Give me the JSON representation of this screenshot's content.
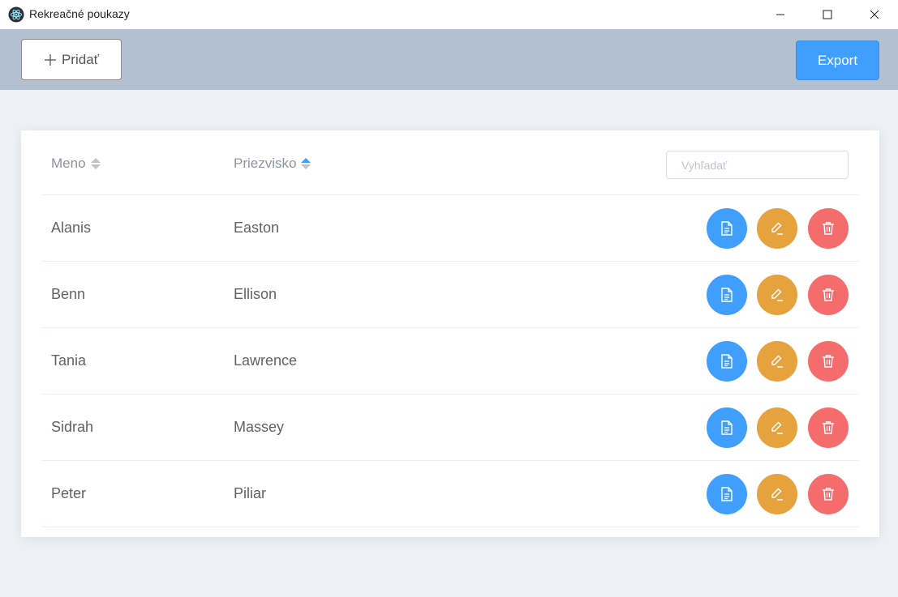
{
  "window": {
    "title": "Rekreačné poukazy"
  },
  "toolbar": {
    "add_label": "Pridať",
    "export_label": "Export"
  },
  "table": {
    "columns": [
      {
        "label": "Meno",
        "sort": "none"
      },
      {
        "label": "Priezvisko",
        "sort": "ascending"
      }
    ],
    "search_placeholder": "Vyhľadať",
    "rows": [
      {
        "meno": "Alanis",
        "priezvisko": "Easton"
      },
      {
        "meno": "Benn",
        "priezvisko": "Ellison"
      },
      {
        "meno": "Tania",
        "priezvisko": "Lawrence"
      },
      {
        "meno": "Sidrah",
        "priezvisko": "Massey"
      },
      {
        "meno": "Peter",
        "priezvisko": "Piliar"
      }
    ],
    "row_actions": [
      "document-icon",
      "edit-icon",
      "delete-icon"
    ]
  },
  "colors": {
    "primary": "#409eff",
    "warning": "#e6a23c",
    "danger": "#f56c6c",
    "header_bg": "#b3c0d1",
    "page_bg": "#edf0f4"
  }
}
